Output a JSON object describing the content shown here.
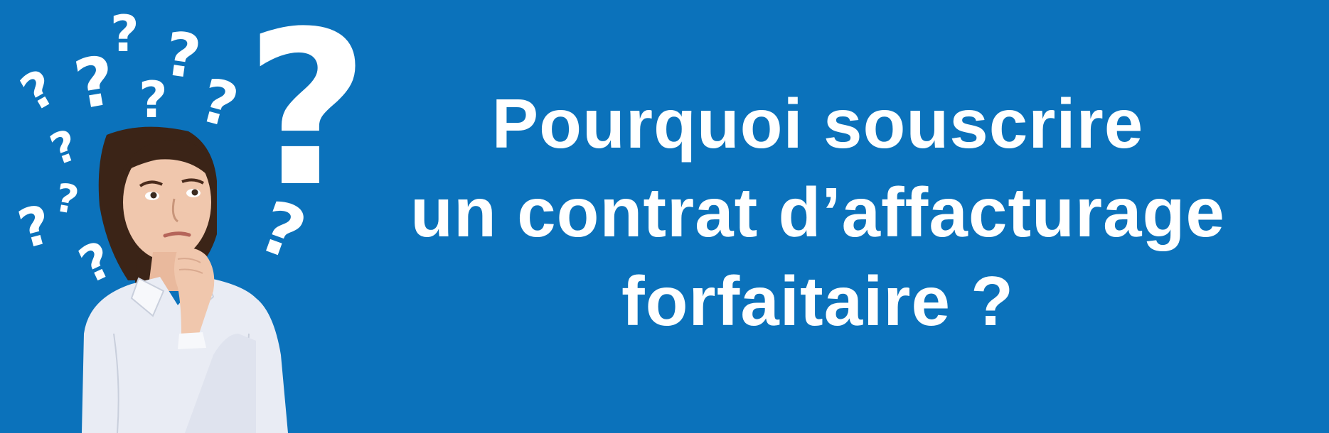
{
  "banner": {
    "background_color": "#0b72bb",
    "headline_lines": [
      "Pourquoi souscrire",
      "un contrat d’affacturage",
      "forfaitaire ?"
    ]
  },
  "illustration": {
    "person": "thinking-woman",
    "icons": [
      "question-mark-icon"
    ]
  }
}
